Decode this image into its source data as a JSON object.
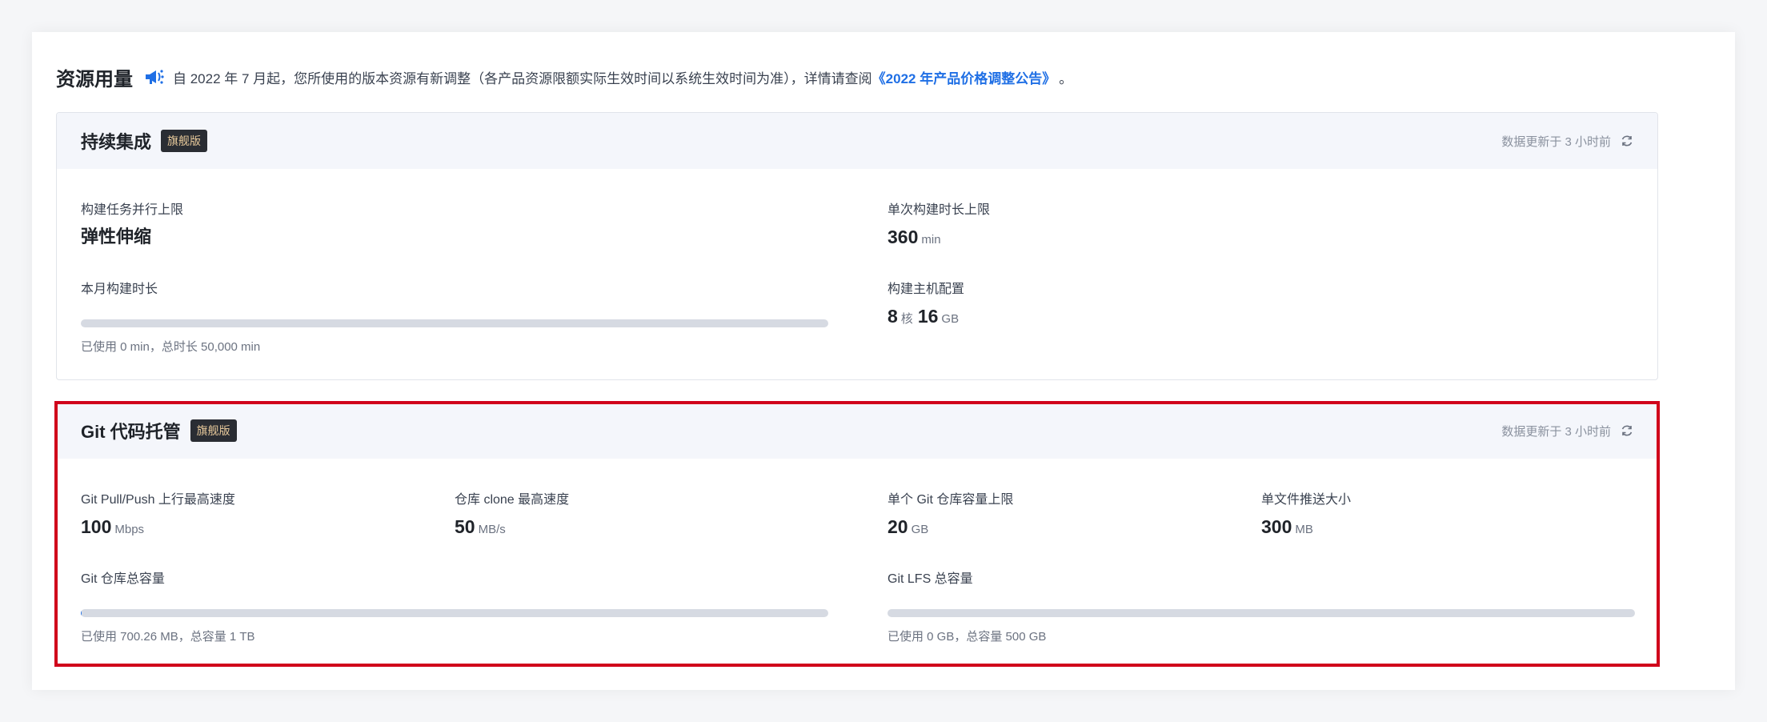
{
  "header": {
    "title": "资源用量",
    "notice": "自 2022 年 7 月起，您所使用的版本资源有新调整（各产品资源限额实际生效时间以系统生效时间为准），详情请查阅",
    "link": "《2022 年产品价格调整公告》",
    "end": "。",
    "icon": "megaphone-icon",
    "accent_color": "#1f6fe5"
  },
  "ci": {
    "title": "持续集成",
    "badge": "旗舰版",
    "updated": "数据更新于 3 小时前",
    "parallel_label": "构建任务并行上限",
    "parallel_value": "弹性伸缩",
    "duration_label": "单次构建时长上限",
    "duration_value": "360",
    "duration_unit": "min",
    "monthly_label": "本月构建时长",
    "monthly_used": 0,
    "monthly_total": 50000,
    "monthly_caption": "已使用 0 min，总时长 50,000 min",
    "host_label": "构建主机配置",
    "host_cores": "8",
    "host_cores_unit": "核",
    "host_mem": "16",
    "host_mem_unit": "GB"
  },
  "git": {
    "title": "Git 代码托管",
    "badge": "旗舰版",
    "updated": "数据更新于 3 小时前",
    "pull_push_label": "Git Pull/Push 上行最高速度",
    "pull_push_value": "100",
    "pull_push_unit": "Mbps",
    "clone_label": "仓库 clone 最高速度",
    "clone_value": "50",
    "clone_unit": "MB/s",
    "repo_limit_label": "单个 Git 仓库容量上限",
    "repo_limit_value": "20",
    "repo_limit_unit": "GB",
    "file_push_label": "单文件推送大小",
    "file_push_value": "300",
    "file_push_unit": "MB",
    "repo_total_label": "Git 仓库总容量",
    "repo_total_fraction": 0.0007,
    "repo_total_caption": "已使用 700.26 MB，总容量 1 TB",
    "lfs_label": "Git LFS 总容量",
    "lfs_fraction": 0,
    "lfs_caption": "已使用 0 GB，总容量 500 GB"
  },
  "colors": {
    "highlight_border": "#d0021b",
    "badge_bg": "#2a2d33",
    "badge_text": "#e6c89a"
  }
}
